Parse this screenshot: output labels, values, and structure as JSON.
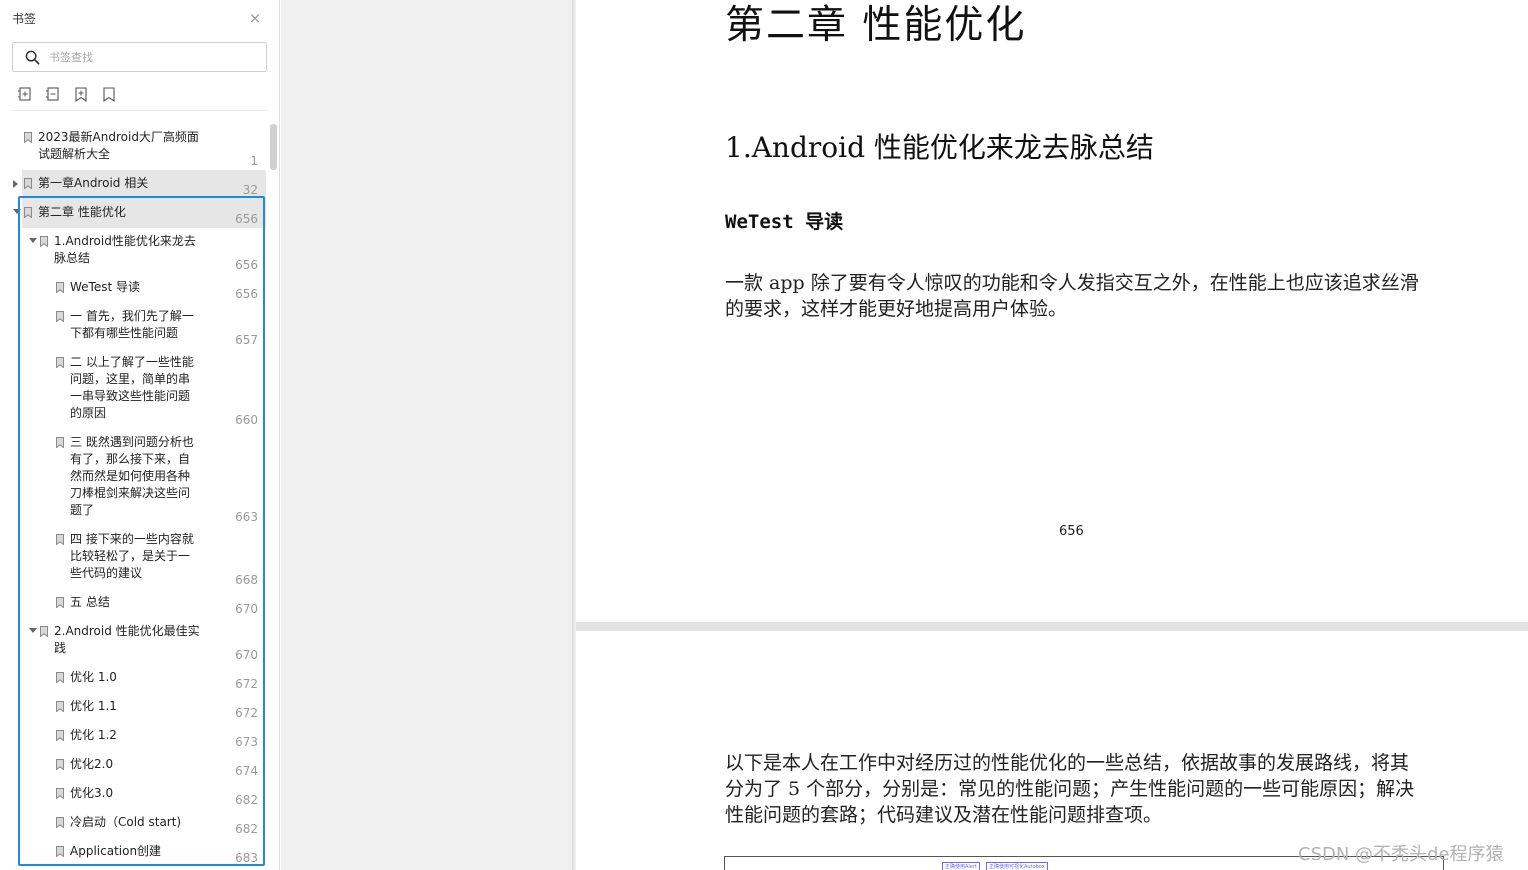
{
  "panel": {
    "title": "书签",
    "close_glyph": "×",
    "search_placeholder": "书签查找",
    "toolbar": [
      {
        "name": "expand-all-icon"
      },
      {
        "name": "collapse-all-icon"
      },
      {
        "name": "add-bookmark-icon"
      },
      {
        "name": "bookmark-icon"
      }
    ]
  },
  "bookmarks": [
    {
      "label": "2023最新Android大厂高频面试题解析大全",
      "page": "1",
      "level": 0,
      "expander": "none"
    },
    {
      "label": "第一章Android 相关",
      "page": "32",
      "level": 0,
      "expander": "collapsed"
    },
    {
      "label": "第二章 性能优化",
      "page": "656",
      "level": 0,
      "expander": "expanded"
    },
    {
      "label": "1.Android性能优化来龙去脉总结",
      "page": "656",
      "level": 1,
      "expander": "expanded"
    },
    {
      "label": "WeTest 导读",
      "page": "656",
      "level": 2,
      "expander": "none"
    },
    {
      "label": "一 首先，我们先了解一下都有哪些性能问题",
      "page": "657",
      "level": 2,
      "expander": "none"
    },
    {
      "label": "二 以上了解了一些性能问题，这里，简单的串一串导致这些性能问题的原因",
      "page": "660",
      "level": 2,
      "expander": "none"
    },
    {
      "label": "三 既然遇到问题分析也有了，那么接下来，自然而然是如何使用各种刀棒棍剑来解决这些问题了",
      "page": "663",
      "level": 2,
      "expander": "none"
    },
    {
      "label": "四 接下来的一些内容就比较轻松了，是关于一些代码的建议",
      "page": "668",
      "level": 2,
      "expander": "none"
    },
    {
      "label": "五 总结",
      "page": "670",
      "level": 2,
      "expander": "none"
    },
    {
      "label": "2.Android 性能优化最佳实践",
      "page": "670",
      "level": 1,
      "expander": "expanded"
    },
    {
      "label": "优化 1.0",
      "page": "672",
      "level": 2,
      "expander": "none"
    },
    {
      "label": "优化 1.1",
      "page": "672",
      "level": 2,
      "expander": "none"
    },
    {
      "label": "优化 1.2",
      "page": "673",
      "level": 2,
      "expander": "none"
    },
    {
      "label": "优化2.0",
      "page": "674",
      "level": 2,
      "expander": "none"
    },
    {
      "label": "优化3.0",
      "page": "682",
      "level": 2,
      "expander": "none"
    },
    {
      "label": "冷启动（Cold start)",
      "page": "682",
      "level": 2,
      "expander": "none"
    },
    {
      "label": "Application创建",
      "page": "683",
      "level": 2,
      "expander": "none"
    }
  ],
  "document": {
    "chapter_title": "第二章  性能优化",
    "section_title": "1.Android 性能优化来龙去脉总结",
    "subsection_title": "WeTest 导读",
    "intro_paragraph": "一款 app 除了要有令人惊叹的功能和令人发指交互之外，在性能上也应该追求丝滑的要求，这样才能更好地提高用户体验。",
    "page_number": "656",
    "page2_paragraph": "以下是本人在工作中对经历过的性能优化的一些总结，依据故事的发展路线，将其分为了 5 个部分，分别是：常见的性能问题；产生性能问题的一些可能原因；解决性能问题的套路；代码建议及潜在性能问题排查项。",
    "figure_labels": [
      "正确使用Alert",
      "正确使用可视化Autobox"
    ]
  },
  "watermark": "CSDN @不秃头de程序猿",
  "colors": {
    "selection": "#1e8be0",
    "shade": "#e6e6e6"
  }
}
